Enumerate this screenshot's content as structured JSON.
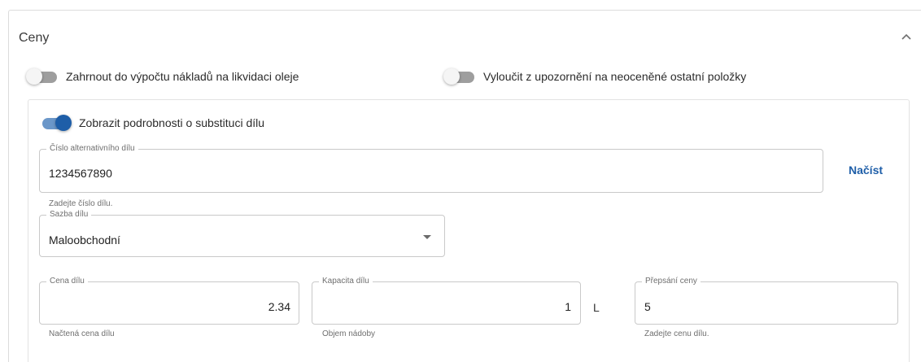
{
  "section": {
    "title": "Ceny"
  },
  "toggles": {
    "oil_disposal": {
      "label": "Zahrnout do výpočtu nákladů na likvidaci oleje",
      "on": false
    },
    "exclude_unpriced": {
      "label": "Vyloučit z upozornění na neoceněné ostatní položky",
      "on": false
    },
    "substitution_details": {
      "label": "Zobrazit podrobnosti o substituci dílu",
      "on": true
    }
  },
  "alt_part": {
    "label": "Číslo alternativního dílu",
    "value": "1234567890",
    "hint": "Zadejte číslo dílu.",
    "load_label": "Načíst"
  },
  "part_rate": {
    "label": "Sazba dílu",
    "value": "Maloobchodní"
  },
  "part_price": {
    "label": "Cena dílu",
    "value": "2.34",
    "hint": "Načtená cena dílu"
  },
  "part_capacity": {
    "label": "Kapacita dílu",
    "value": "1",
    "unit": "L",
    "hint": "Objem nádoby"
  },
  "price_override": {
    "label": "Přepsání ceny",
    "value": "5",
    "hint": "Zadejte cenu dílu."
  },
  "colors": {
    "accent": "#1e5ea8",
    "toggle_off_track": "#9e9e9e",
    "toggle_on_track": "#6b97c9"
  }
}
